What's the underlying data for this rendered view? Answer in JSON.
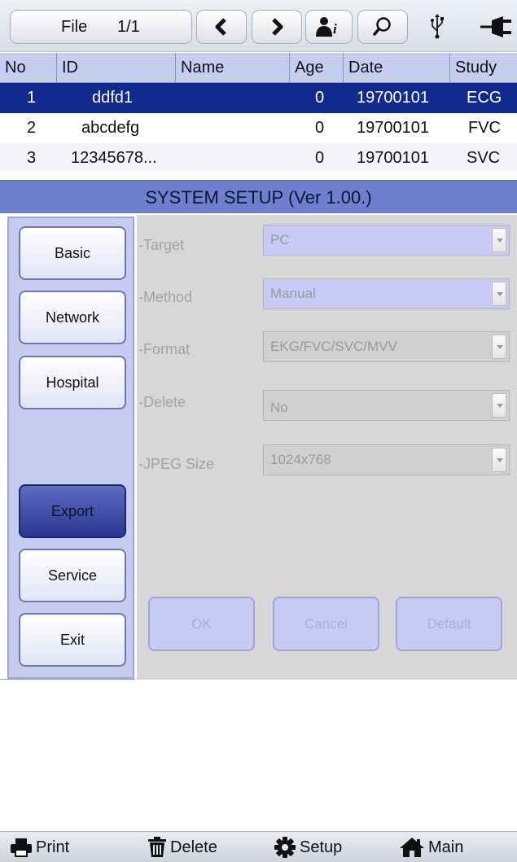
{
  "toolbar": {
    "file_label": "File",
    "page_indicator": "1/1",
    "buttons": [
      "chevron-left-icon",
      "chevron-right-icon",
      "patient-info-icon",
      "search-icon",
      "usb-icon",
      "power-plug-icon"
    ]
  },
  "table": {
    "headers": [
      "No",
      "ID",
      "Name",
      "Age",
      "Date",
      "Study"
    ],
    "rows": [
      {
        "no": "1",
        "id": "ddfd1",
        "name": "",
        "age": "0",
        "date": "19700101",
        "study": "ECG",
        "selected": true
      },
      {
        "no": "2",
        "id": "abcdefg",
        "name": "",
        "age": "0",
        "date": "19700101",
        "study": "FVC",
        "selected": false
      },
      {
        "no": "3",
        "id": "12345678...",
        "name": "",
        "age": "0",
        "date": "19700101",
        "study": "SVC",
        "selected": false
      }
    ]
  },
  "setup": {
    "title": "SYSTEM SETUP (Ver 1.00.)",
    "nav": [
      {
        "label": "Basic",
        "active": false
      },
      {
        "label": "Network",
        "active": false
      },
      {
        "label": "Hospital",
        "active": false
      },
      {
        "label": "Export",
        "active": true
      },
      {
        "label": "Service",
        "active": false
      },
      {
        "label": "Exit",
        "active": false
      }
    ],
    "fields": [
      {
        "label": "-Target",
        "value": "PC"
      },
      {
        "label": "-Method",
        "value": "Manual"
      },
      {
        "label": "-Format",
        "value": "EKG/FVC/SVC/MVV"
      },
      {
        "label": "-Delete",
        "value": "No"
      },
      {
        "label": "-JPEG Size",
        "value": "1024x768"
      }
    ],
    "actions": {
      "ok": "OK",
      "cancel": "Cancel",
      "default": "Default"
    }
  },
  "bottom": {
    "print": "Print",
    "delete": "Delete",
    "setup": "Setup",
    "main": "Main"
  },
  "colors": {
    "selected_row": "#112a8d",
    "header_row": "#c5cdf0",
    "setup_title_bar": "#6e7fd0",
    "sidebar": "#c6cbf0",
    "active_nav": "#2b388f"
  }
}
